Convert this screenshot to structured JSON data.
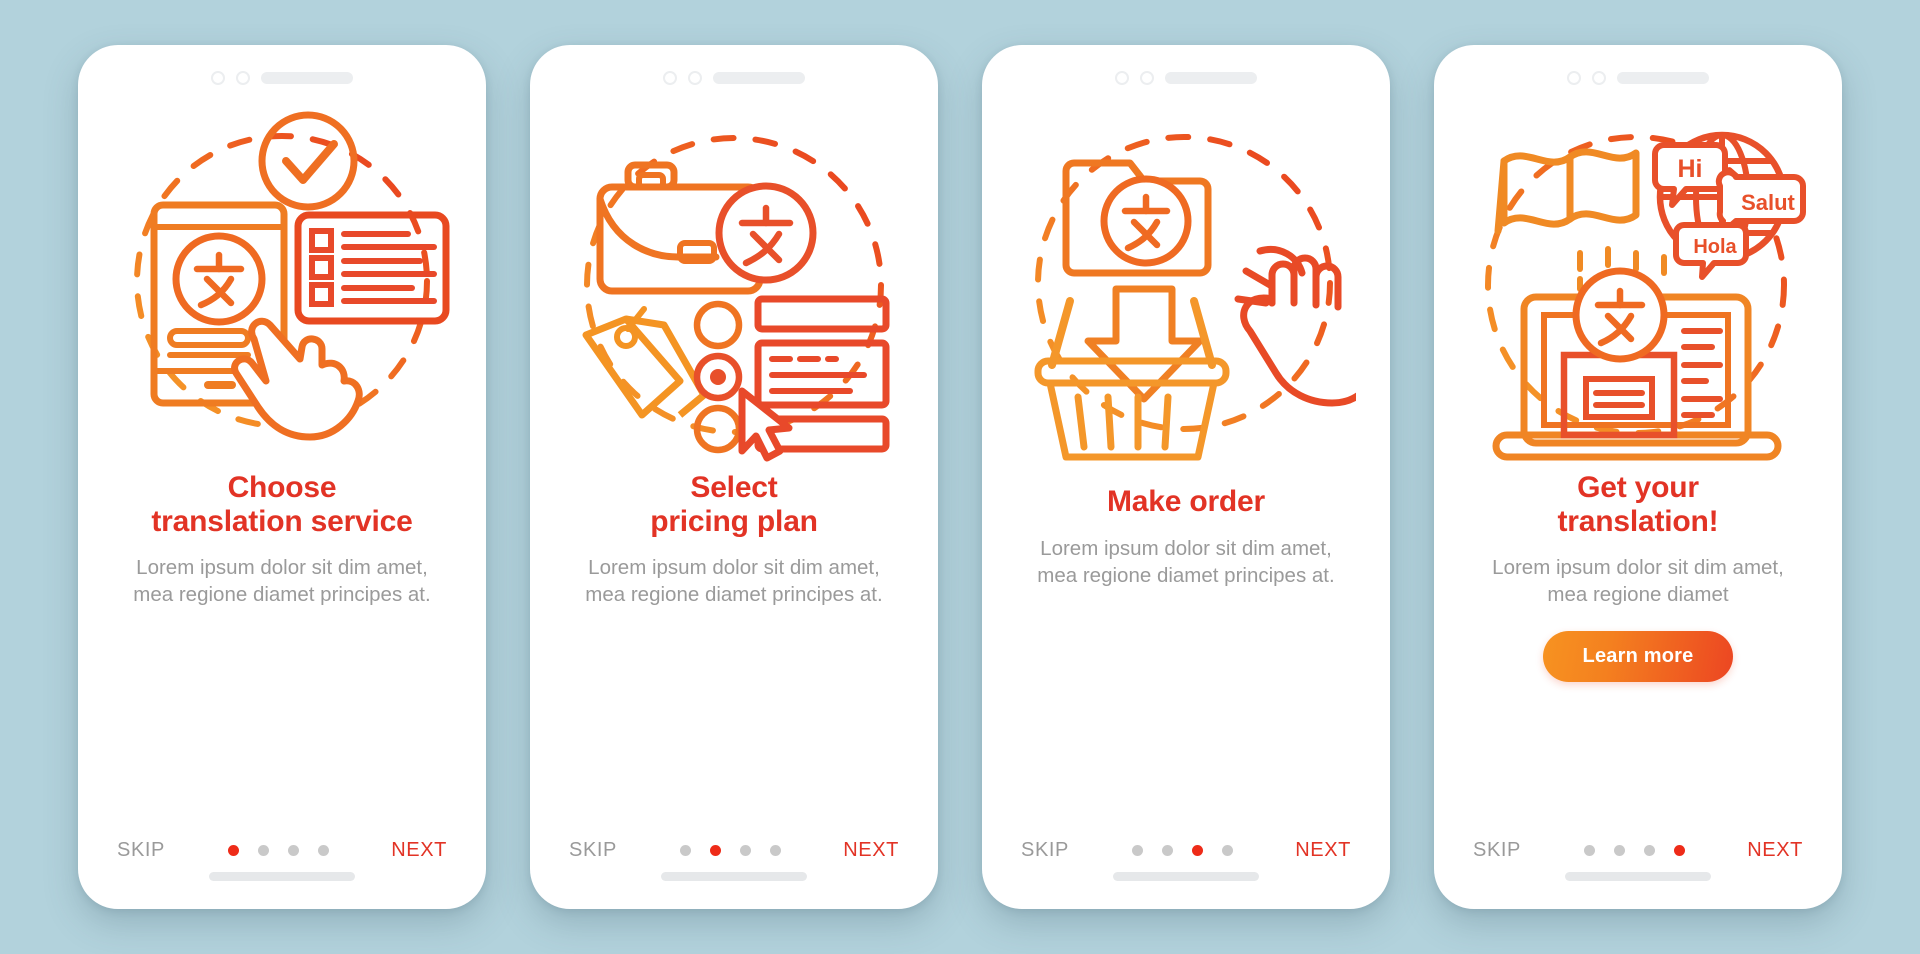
{
  "theme": {
    "background": "#b2d2dc",
    "card_background": "#ffffff",
    "title_color": "#e23325",
    "desc_color": "#9a9a9a",
    "accent_orange": "#f4801f",
    "accent_red": "#ec4622",
    "dot_active": "#ee2b18",
    "dot_inactive": "#c9c9c9"
  },
  "common": {
    "skip_label": "SKIP",
    "next_label": "NEXT",
    "total_dots": 4,
    "translate_glyph": "文"
  },
  "screens": [
    {
      "title_line1": "Choose",
      "title_line2": "translation service",
      "description": "Lorem ipsum dolor sit dim amet, mea regione diamet principes at.",
      "active_dot": 1,
      "skip_label": "SKIP",
      "next_label": "NEXT",
      "has_cta": false,
      "cta_label": ""
    },
    {
      "title_line1": "Select",
      "title_line2": "pricing plan",
      "description": "Lorem ipsum dolor sit dim amet, mea regione diamet principes at.",
      "active_dot": 2,
      "skip_label": "SKIP",
      "next_label": "NEXT",
      "has_cta": false,
      "cta_label": ""
    },
    {
      "title_line1": "Make order",
      "title_line2": "",
      "description": "Lorem ipsum dolor sit dim amet, mea regione diamet principes at.",
      "active_dot": 3,
      "skip_label": "SKIP",
      "next_label": "NEXT",
      "has_cta": false,
      "cta_label": ""
    },
    {
      "title_line1": "Get your",
      "title_line2": "translation!",
      "description": "Lorem ipsum dolor sit dim amet, mea regione diamet",
      "active_dot": 4,
      "skip_label": "SKIP",
      "next_label": "NEXT",
      "has_cta": true,
      "cta_label": "Learn more"
    }
  ],
  "illustrations": {
    "screen1": {
      "name": "choose-translation-service-illustration",
      "elements": [
        "check-circle-icon",
        "phone-document-icon",
        "translate-glyph-circle",
        "checklist-card-icon",
        "pointing-hand-icon",
        "dashed-circle"
      ]
    },
    "screen2": {
      "name": "select-pricing-plan-illustration",
      "elements": [
        "briefcase-icon",
        "translate-glyph-circle",
        "price-tags-icon",
        "radio-buttons",
        "plan-cards",
        "cursor-arrow-icon",
        "dashed-circle"
      ]
    },
    "screen3": {
      "name": "make-order-illustration",
      "elements": [
        "folder-icon",
        "translate-glyph-circle",
        "down-arrow-icon",
        "shopping-basket-icon",
        "tapping-hand-icon",
        "dashed-circle"
      ]
    },
    "screen4": {
      "name": "get-your-translation-illustration",
      "elements": [
        "flags-icon",
        "globe-icon",
        "laptop-icon",
        "translate-glyph-circle",
        "dashed-circle"
      ],
      "speech_bubbles": [
        "Hi",
        "Salut",
        "Hola"
      ]
    }
  }
}
